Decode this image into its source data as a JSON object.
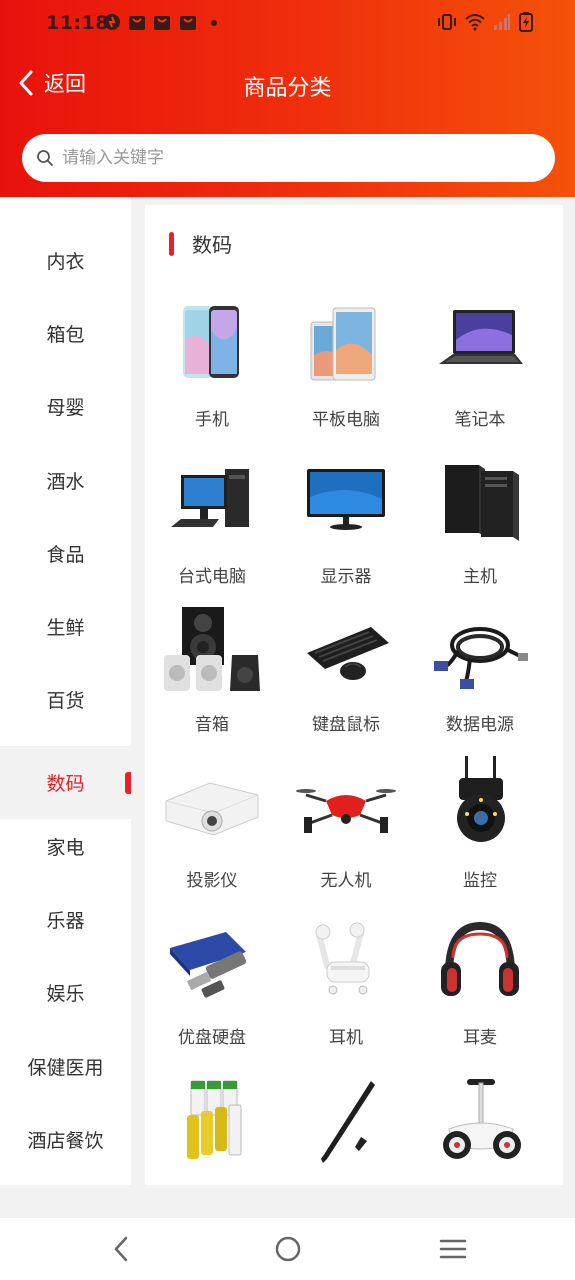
{
  "status_bar": {
    "time": "11:18"
  },
  "header": {
    "back_label": "返回",
    "title": "商品分类"
  },
  "search": {
    "placeholder": "请输入关键字"
  },
  "sidebar": {
    "items": [
      "内衣",
      "箱包",
      "母婴",
      "酒水",
      "食品",
      "生鲜",
      "百货",
      "数码",
      "家电",
      "乐器",
      "娱乐",
      "保健医用",
      "酒店餐饮"
    ],
    "active": "数码"
  },
  "content": {
    "section_title": "数码",
    "items": [
      {
        "label": "手机",
        "icon": "phone-icon"
      },
      {
        "label": "平板电脑",
        "icon": "tablet-icon"
      },
      {
        "label": "笔记本",
        "icon": "laptop-icon"
      },
      {
        "label": "台式电脑",
        "icon": "desktop-icon"
      },
      {
        "label": "显示器",
        "icon": "monitor-icon"
      },
      {
        "label": "主机",
        "icon": "pc-tower-icon"
      },
      {
        "label": "音箱",
        "icon": "speaker-icon"
      },
      {
        "label": "键盘鼠标",
        "icon": "keyboard-mouse-icon"
      },
      {
        "label": "数据电源",
        "icon": "cable-icon"
      },
      {
        "label": "投影仪",
        "icon": "projector-icon"
      },
      {
        "label": "无人机",
        "icon": "drone-icon"
      },
      {
        "label": "监控",
        "icon": "camera-icon"
      },
      {
        "label": "优盘硬盘",
        "icon": "usb-drive-icon"
      },
      {
        "label": "耳机",
        "icon": "earbuds-icon"
      },
      {
        "label": "耳麦",
        "icon": "headphones-icon"
      },
      {
        "label": "",
        "icon": "battery-icon"
      },
      {
        "label": "",
        "icon": "stylus-icon"
      },
      {
        "label": "",
        "icon": "balance-scooter-icon"
      }
    ]
  },
  "colors": {
    "header_start": "#e8120c",
    "header_end": "#f5520a",
    "accent": "#e8202a"
  }
}
